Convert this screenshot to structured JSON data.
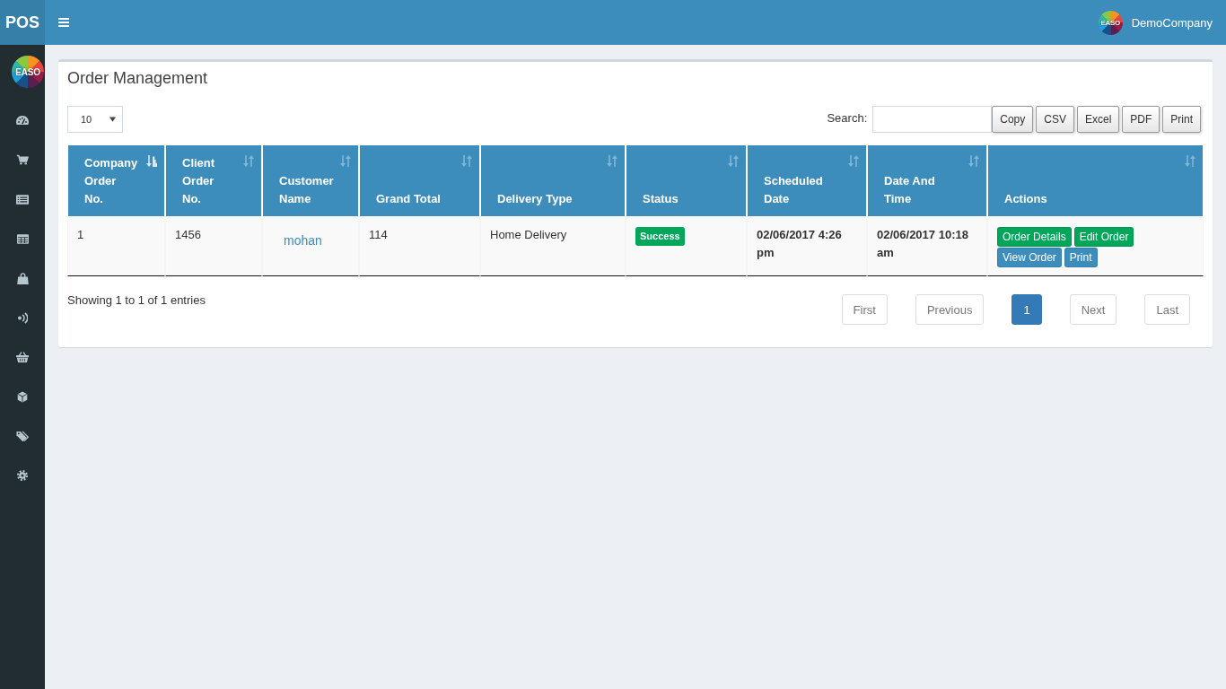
{
  "header": {
    "brand": "POS",
    "user": {
      "logo_text": "EASO",
      "name": "DemoCompany"
    }
  },
  "sidebar": {
    "logo_text": "EASO"
  },
  "panel": {
    "title": "Order Management",
    "page_length": "10",
    "search": {
      "label": "Search:"
    },
    "buttons": [
      "Copy",
      "CSV",
      "Excel",
      "PDF",
      "Print"
    ],
    "table": {
      "columns": [
        {
          "label": "Company Order No.",
          "sorted": true
        },
        {
          "label": "Client Order No.",
          "sorted": false
        },
        {
          "label": "Customer Name",
          "sorted": false
        },
        {
          "label": "Grand Total",
          "sorted": false
        },
        {
          "label": "Delivery Type",
          "sorted": false
        },
        {
          "label": "Status",
          "sorted": false
        },
        {
          "label": "Scheduled Date",
          "sorted": false
        },
        {
          "label": "Date And Time",
          "sorted": false
        },
        {
          "label": "Actions",
          "sorted": false
        }
      ],
      "rows": [
        {
          "cells": [
            {
              "kind": "text",
              "text": "1"
            },
            {
              "kind": "text",
              "text": "1456"
            },
            {
              "kind": "link",
              "text": "mohan"
            },
            {
              "kind": "text",
              "text": "114"
            },
            {
              "kind": "text",
              "text": "Home Delivery"
            },
            {
              "kind": "label",
              "text": "Success",
              "color": "#00a65a"
            },
            {
              "kind": "bold",
              "text": "02/06/2017 4:26 pm"
            },
            {
              "kind": "bold",
              "text": "02/06/2017 10:18 am"
            },
            {
              "kind": "actions",
              "buttons": [
                {
                  "label": "Order Details",
                  "color": "#00a65a"
                },
                {
                  "label": "Edit Order",
                  "color": "#00a65a"
                },
                {
                  "label": "View Order",
                  "color": "#3c8dbc"
                },
                {
                  "label": "Print",
                  "color": "#3c8dbc"
                }
              ]
            }
          ]
        }
      ]
    },
    "info": "Showing 1 to 1 of 1 entries",
    "pagination": [
      {
        "label": "First",
        "selected": false,
        "disabled": true
      },
      {
        "label": "Previous",
        "selected": false,
        "disabled": true
      },
      {
        "label": "1",
        "selected": true,
        "disabled": false
      },
      {
        "label": "Next",
        "selected": false,
        "disabled": true
      },
      {
        "label": "Last",
        "selected": false,
        "disabled": true
      }
    ]
  }
}
